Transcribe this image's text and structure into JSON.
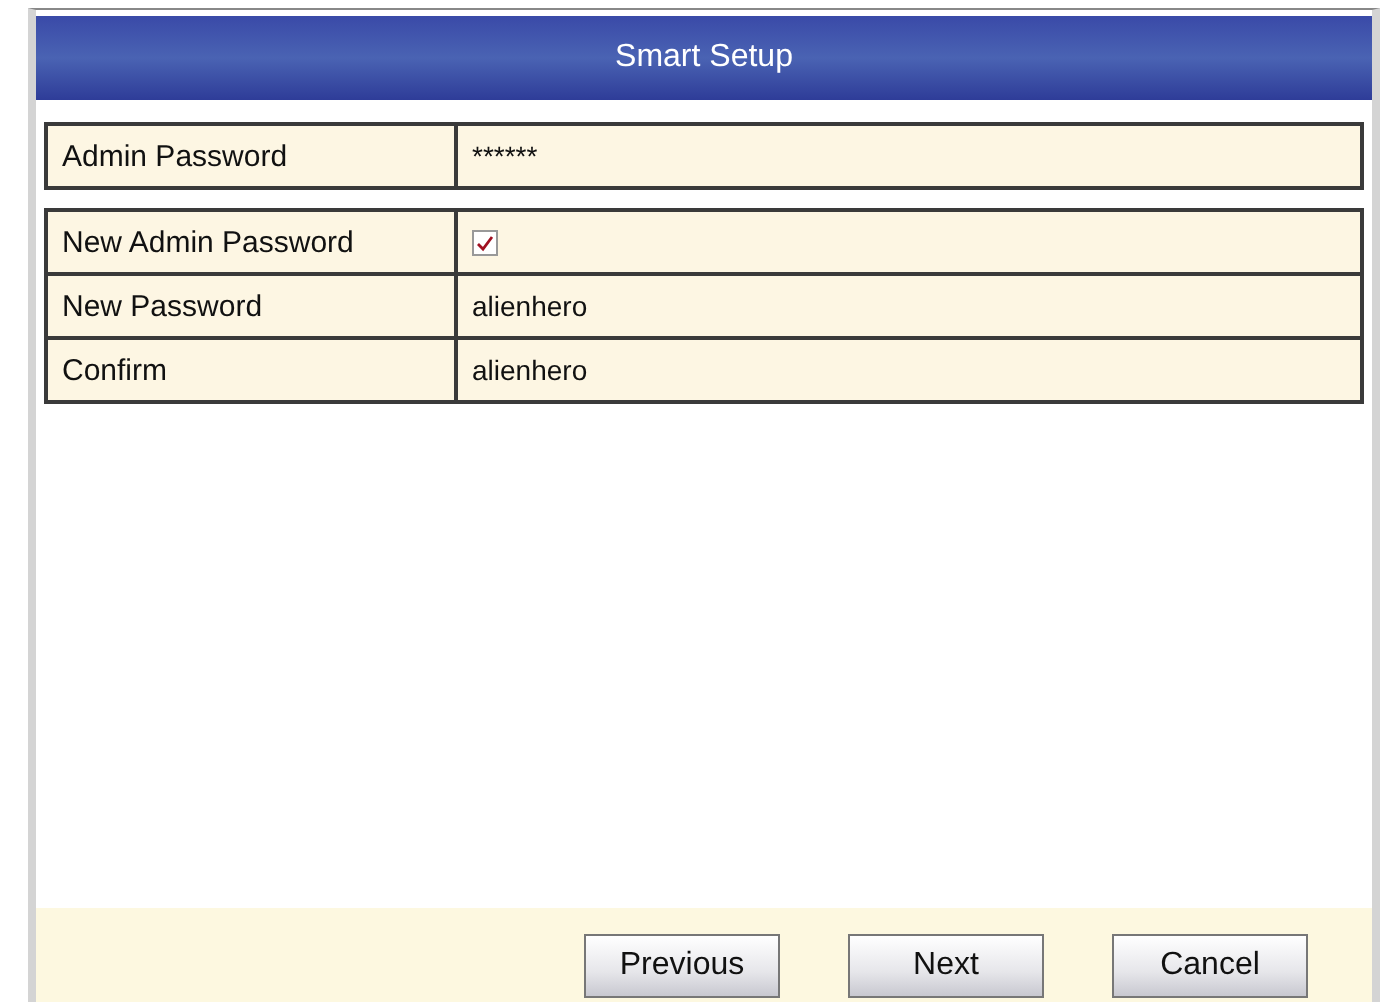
{
  "window": {
    "title": "Smart Setup"
  },
  "groups": [
    {
      "rows": [
        {
          "kind": "text",
          "label": "Admin Password",
          "value": "******"
        }
      ]
    },
    {
      "rows": [
        {
          "kind": "checkbox",
          "label": "New Admin Password",
          "checked": true
        },
        {
          "kind": "text",
          "label": "New Password",
          "value": "alienhero"
        },
        {
          "kind": "text",
          "label": "Confirm",
          "value": "alienhero"
        }
      ]
    }
  ],
  "buttons": [
    "Previous",
    "Next",
    "Cancel"
  ]
}
